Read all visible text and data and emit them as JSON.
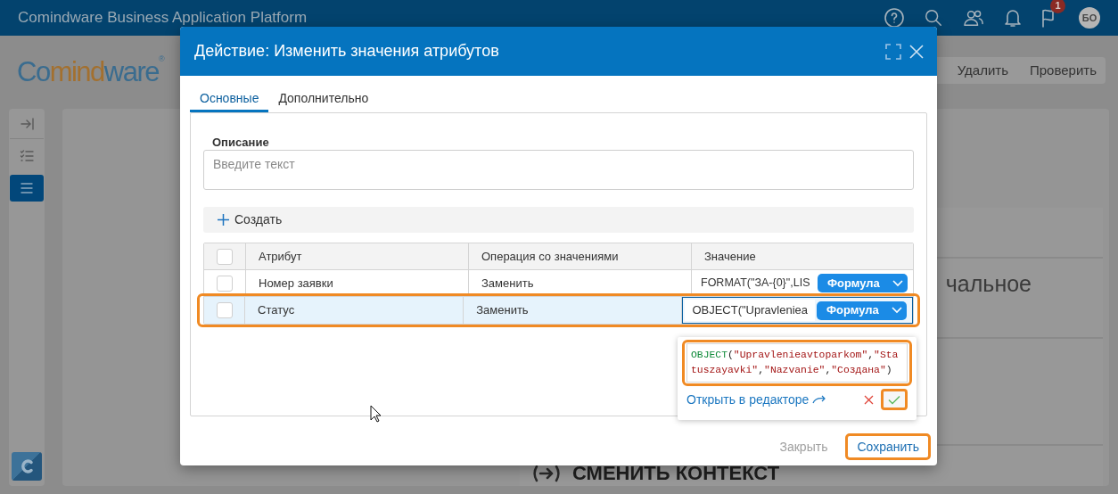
{
  "app_bar": {
    "title": "Comindware Business Application Platform",
    "notification_count": "1",
    "avatar_initials": "БО"
  },
  "page": {
    "logo_parts": [
      "Co",
      "mind",
      "ware"
    ],
    "logo_mark": "®",
    "toolbar_buttons": [
      "Удалить",
      "Проверить"
    ],
    "heading_fragment": "чальное",
    "footer_heading": "СМЕНИТЬ КОНТЕКСТ"
  },
  "sidebar": {
    "items": [
      {
        "kind": "collapse",
        "selected": false
      },
      {
        "kind": "checklist",
        "selected": false
      },
      {
        "kind": "list",
        "selected": true
      }
    ]
  },
  "dialog": {
    "title": "Действие: Изменить значения атрибутов",
    "tabs": [
      {
        "label": "Основные",
        "selected": true
      },
      {
        "label": "Дополнительно",
        "selected": false
      }
    ],
    "description": {
      "label": "Описание",
      "placeholder": "Введите текст"
    },
    "create_button": "Создать",
    "table": {
      "columns": [
        "Атрибут",
        "Операция со значениями",
        "Значение"
      ],
      "header_checked": false,
      "rows": [
        {
          "attribute": "Номер заявки",
          "operation": "Заменить",
          "value": "FORMAT(\"ЗА-{0}\",LIS",
          "value_type": "Формула",
          "checked": false,
          "selected": false,
          "editing": false,
          "highlighted": false
        },
        {
          "attribute": "Статус",
          "operation": "Заменить",
          "value": "OBJECT(\"Upravleniea",
          "value_type": "Формула",
          "checked": false,
          "selected": true,
          "editing": true,
          "highlighted": true
        }
      ]
    },
    "formula_popup": {
      "code": "OBJECT(\"Upravlenieavtoparkom\",\"Statuszayavki\",\"Nazvanie\",\"Создана\")",
      "code_highlighted": true,
      "open_in_editor": "Открыть в редакторе",
      "confirm_highlighted": true
    },
    "buttons": {
      "close": "Закрыть",
      "save": "Сохранить",
      "save_highlighted": true
    }
  }
}
